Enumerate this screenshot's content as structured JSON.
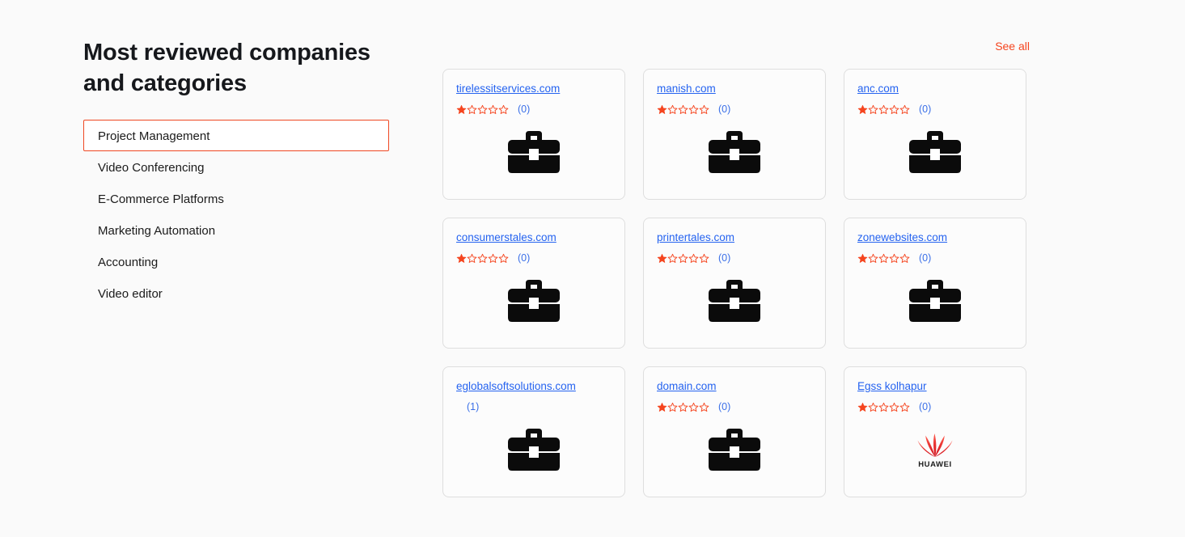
{
  "heading": "Most reviewed companies and categories",
  "sidebar": {
    "items": [
      {
        "label": "Project Management",
        "selected": true
      },
      {
        "label": "Video Conferencing",
        "selected": false
      },
      {
        "label": "E-Commerce Platforms",
        "selected": false
      },
      {
        "label": "Marketing Automation",
        "selected": false
      },
      {
        "label": "Accounting",
        "selected": false
      },
      {
        "label": "Video editor",
        "selected": false
      }
    ]
  },
  "see_all": {
    "label": "See all"
  },
  "colors": {
    "accent": "#f5451f",
    "selected_border": "#ef4823",
    "link_blue": "#2563f0",
    "count_blue": "#3a6fe8",
    "star_filled": "#f5451f",
    "star_outline": "#f5451f",
    "card_border": "#dedede",
    "page_background": "#fafafa",
    "briefcase": "#0b0b0b",
    "huawei_red": "#e60f1f"
  },
  "cards": [
    {
      "name": "tirelessitservices.com",
      "stars_filled": 1,
      "stars_total": 5,
      "has_stars": true,
      "review_count": "(0)",
      "logo": "briefcase-icon"
    },
    {
      "name": "manish.com",
      "stars_filled": 1,
      "stars_total": 5,
      "has_stars": true,
      "review_count": "(0)",
      "logo": "briefcase-icon"
    },
    {
      "name": "anc.com",
      "stars_filled": 1,
      "stars_total": 5,
      "has_stars": true,
      "review_count": "(0)",
      "logo": "briefcase-icon"
    },
    {
      "name": "consumerstales.com",
      "stars_filled": 1,
      "stars_total": 5,
      "has_stars": true,
      "review_count": "(0)",
      "logo": "briefcase-icon"
    },
    {
      "name": "printertales.com",
      "stars_filled": 1,
      "stars_total": 5,
      "has_stars": true,
      "review_count": "(0)",
      "logo": "briefcase-icon"
    },
    {
      "name": "zonewebsites.com",
      "stars_filled": 1,
      "stars_total": 5,
      "has_stars": true,
      "review_count": "(0)",
      "logo": "briefcase-icon"
    },
    {
      "name": "eglobalsoftsolutions.com",
      "stars_filled": 0,
      "stars_total": 0,
      "has_stars": false,
      "review_count": "(1)",
      "logo": "briefcase-icon"
    },
    {
      "name": "domain.com",
      "stars_filled": 1,
      "stars_total": 5,
      "has_stars": true,
      "review_count": "(0)",
      "logo": "briefcase-icon"
    },
    {
      "name": "Egss kolhapur",
      "stars_filled": 1,
      "stars_total": 5,
      "has_stars": true,
      "review_count": "(0)",
      "logo": "huawei-logo",
      "logo_text": "HUAWEI"
    }
  ]
}
